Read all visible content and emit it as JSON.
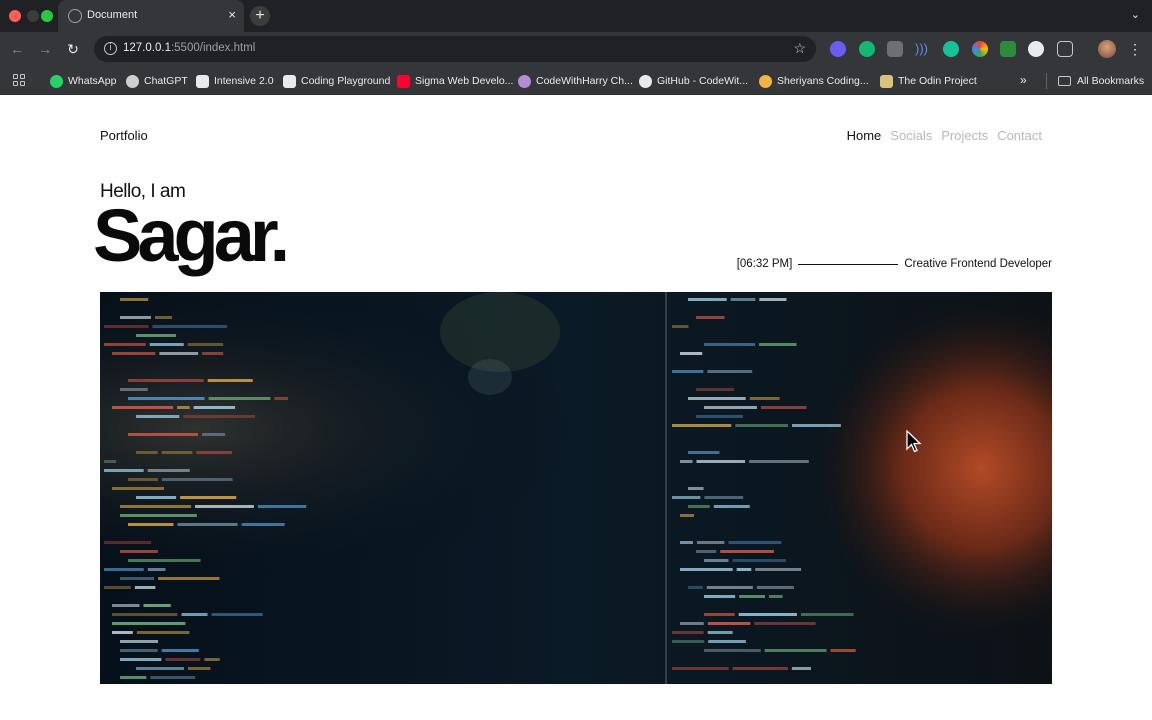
{
  "browser": {
    "tab_title": "Document",
    "tab_close": "×",
    "new_tab": "+",
    "tab_menu": "⌄",
    "url_host": "127.0.0.1",
    "url_path": ":5500/index.html",
    "bookmarks": [
      {
        "label": "WhatsApp",
        "color": "#25d366"
      },
      {
        "label": "ChatGPT",
        "color": "#cfcfcf"
      },
      {
        "label": "Intensive 2.0",
        "color": "#e8eaed"
      },
      {
        "label": "Coding Playground",
        "color": "#e8eaed"
      },
      {
        "label": "Sigma Web Develo...",
        "color": "#ff0033"
      },
      {
        "label": "CodeWithHarry Ch...",
        "color": "#b38bd6"
      },
      {
        "label": "GitHub - CodeWit...",
        "color": "#e8eaed"
      },
      {
        "label": "Sheriyans Coding...",
        "color": "#f2b544"
      },
      {
        "label": "The Odin Project",
        "color": "#d9c27a"
      }
    ],
    "bookmarks_more": "»",
    "all_bookmarks": "All Bookmarks"
  },
  "site": {
    "brand": "Portfolio",
    "nav": [
      {
        "label": "Home",
        "active": true
      },
      {
        "label": "Socials",
        "active": false
      },
      {
        "label": "Projects",
        "active": false
      },
      {
        "label": "Contact",
        "active": false
      }
    ],
    "greeting": "Hello, I am",
    "name": "Sagar.",
    "time": "[06:32 PM]",
    "role": "Creative Frontend Developer"
  },
  "colors": {
    "accent": "#111111",
    "nav_inactive": "#b8b8b8",
    "chrome_dark": "#202124",
    "chrome_toolbar": "#35363a"
  }
}
